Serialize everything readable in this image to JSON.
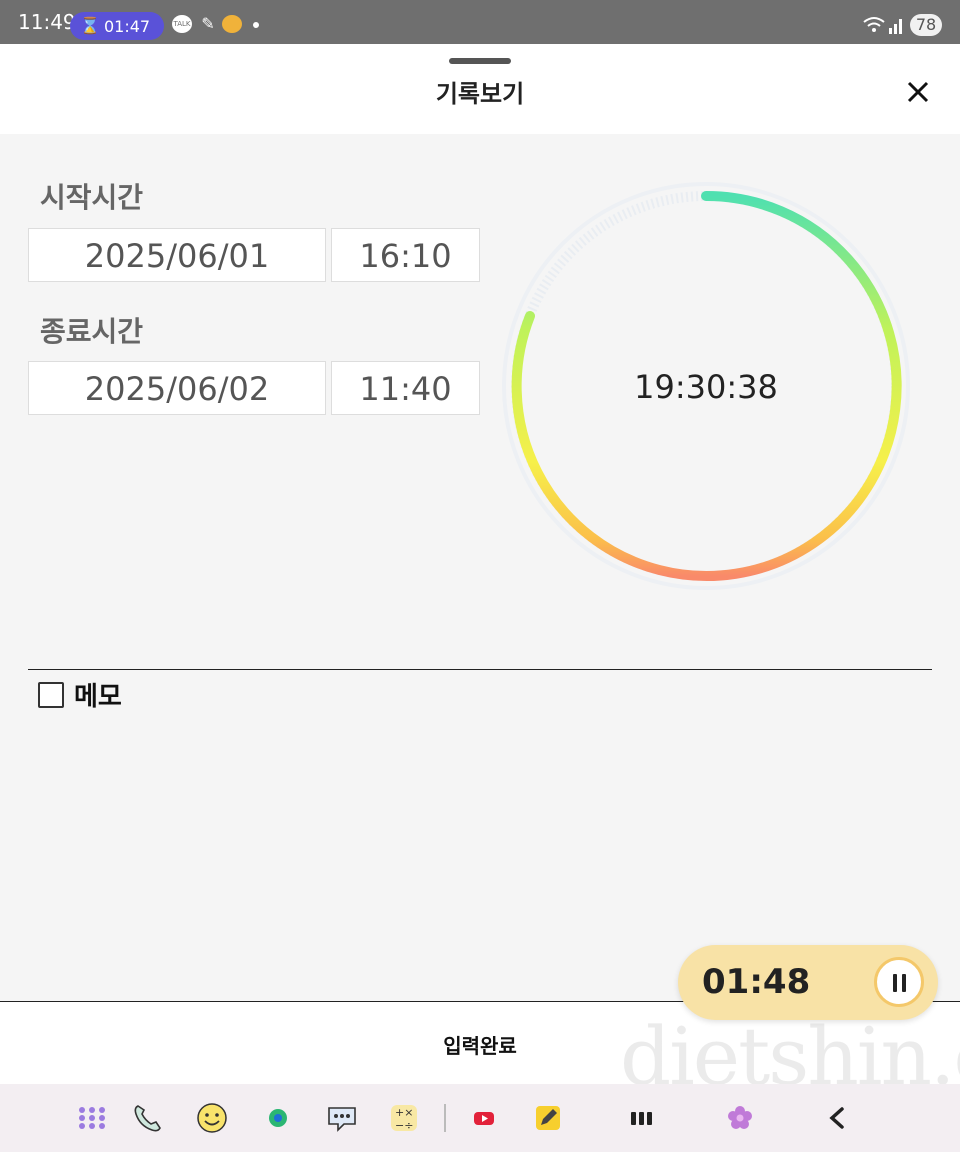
{
  "status_bar": {
    "time": "11:49",
    "timer_pill": "01:47",
    "talk_icon_text": "TALK",
    "battery": "78"
  },
  "header": {
    "title": "기록보기"
  },
  "start": {
    "label": "시작시간",
    "date": "2025/06/01",
    "time": "16:10"
  },
  "end": {
    "label": "종료시간",
    "date": "2025/06/02",
    "time": "11:40"
  },
  "duration": "19:30:38",
  "memo": {
    "label": "메모",
    "checked": false
  },
  "submit_label": "입력완료",
  "watermark": "dietshin.com",
  "floating_timer": {
    "time": "01:48"
  },
  "taskbar_icons": [
    "apps-grid-icon",
    "phone-icon",
    "smiley-icon",
    "naver-browser-icon",
    "chat-bubble-icon",
    "calculator-icon",
    "youtube-icon",
    "notes-pen-icon",
    "recent-apps-icon",
    "flower-app-icon",
    "back-icon"
  ]
}
